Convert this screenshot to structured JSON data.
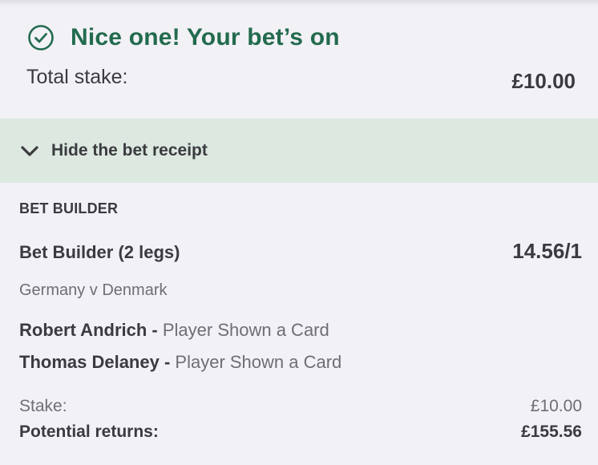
{
  "confirmation": {
    "message": "Nice one! Your bet’s on",
    "icon": "check-circle-icon",
    "color": "#226b4e"
  },
  "total_stake": {
    "label": "Total stake:",
    "value": "£10.00"
  },
  "receipt_toggle": {
    "label": "Hide the bet receipt",
    "icon": "chevron-down-icon",
    "background": "#dce8e0"
  },
  "receipt": {
    "section_title": "BET BUILDER",
    "bet_name": "Bet Builder (2 legs)",
    "odds": "14.56/1",
    "event": "Germany v Denmark",
    "legs": [
      {
        "player": "Robert Andrich",
        "separator": " - ",
        "market": "Player Shown a Card"
      },
      {
        "player": "Thomas Delaney",
        "separator": " - ",
        "market": "Player Shown a Card"
      }
    ],
    "stake_label": "Stake:",
    "stake_value": "£10.00",
    "returns_label": "Potential returns:",
    "returns_value": "£155.56"
  }
}
